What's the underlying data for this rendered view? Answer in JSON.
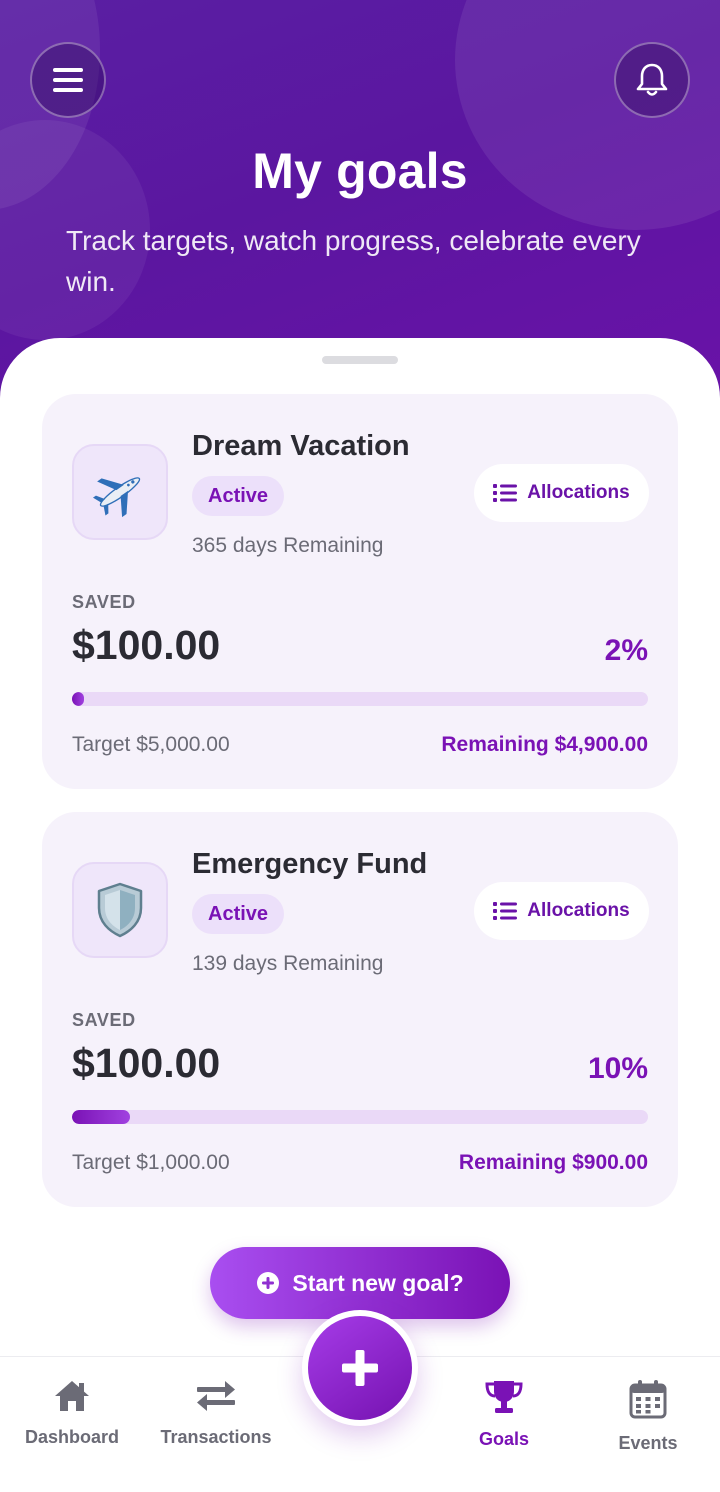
{
  "header": {
    "title": "My goals",
    "subtitle": "Track targets, watch progress, celebrate every win."
  },
  "goals": [
    {
      "name": "Dream Vacation",
      "icon": "airplane-icon",
      "emoji": "✈️",
      "status": "Active",
      "days_remaining": "365 days Remaining",
      "allocations_label": "Allocations",
      "saved_label": "SAVED",
      "saved_amount": "$100.00",
      "percent": "2%",
      "progress_fraction": 0.02,
      "target": "Target $5,000.00",
      "remaining": "Remaining $4,900.00"
    },
    {
      "name": "Emergency Fund",
      "icon": "shield-icon",
      "emoji": "",
      "status": "Active",
      "days_remaining": "139 days Remaining",
      "allocations_label": "Allocations",
      "saved_label": "SAVED",
      "saved_amount": "$100.00",
      "percent": "10%",
      "progress_fraction": 0.1,
      "target": "Target $1,000.00",
      "remaining": "Remaining $900.00"
    }
  ],
  "new_goal_button": "Start new goal?",
  "nav": {
    "items": [
      {
        "label": "Dashboard",
        "icon": "home-icon"
      },
      {
        "label": "Transactions",
        "icon": "swap-arrows-icon"
      },
      {
        "label": "Goals",
        "icon": "trophy-icon",
        "active": true
      },
      {
        "label": "Events",
        "icon": "calendar-icon"
      }
    ]
  },
  "colors": {
    "brand": "#7a12b5",
    "header_bg": "#5b16a0",
    "card_bg": "#f6f2fb",
    "muted_text": "#6b6b76"
  }
}
